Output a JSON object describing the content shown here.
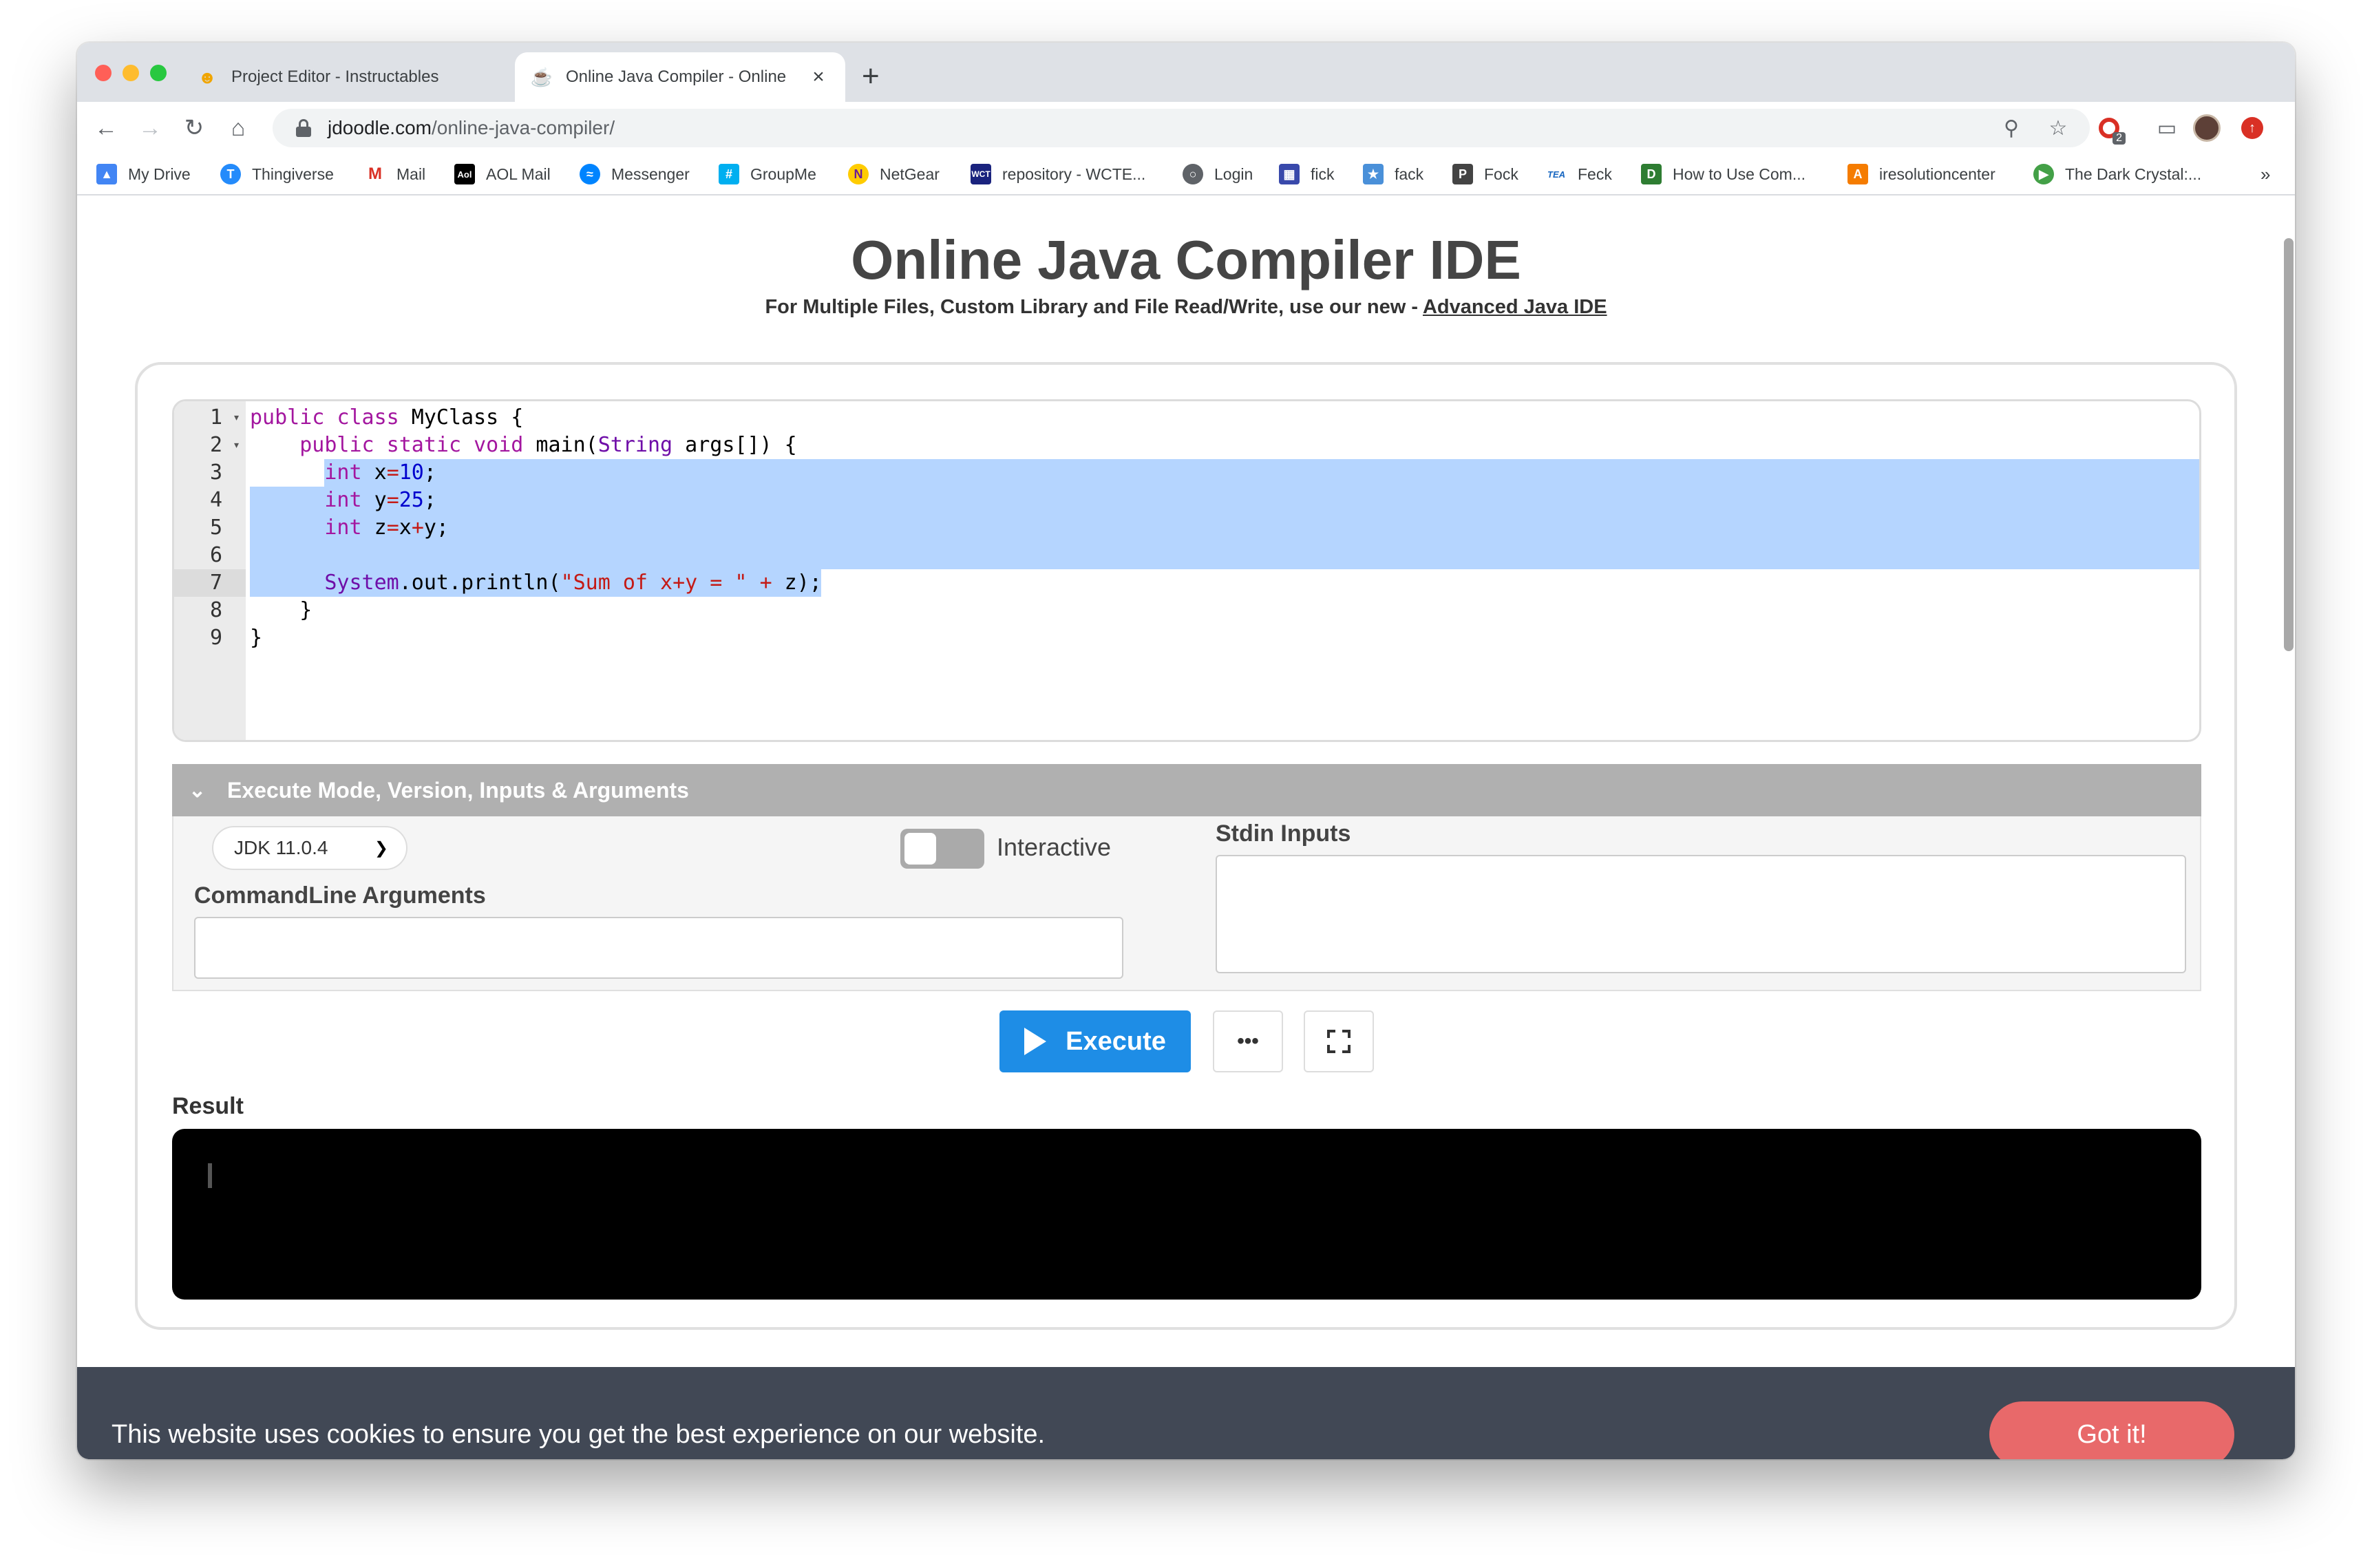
{
  "browser": {
    "tabs": [
      {
        "title": "Project Editor - Instructables",
        "active": false
      },
      {
        "title": "Online Java Compiler - Online",
        "active": true
      }
    ],
    "address": {
      "host": "jdoodle.com",
      "path": "/online-java-compiler/"
    },
    "extension_badge": "2",
    "bookmarks": [
      {
        "label": "My Drive",
        "icon": "drive-icon",
        "color": "#4285f4"
      },
      {
        "label": "Thingiverse",
        "icon": "thingiverse-icon",
        "color": "#248bfb"
      },
      {
        "label": "Mail",
        "icon": "gmail-icon",
        "color": "#d93025"
      },
      {
        "label": "AOL Mail",
        "icon": "aol-icon",
        "color": "#000000"
      },
      {
        "label": "Messenger",
        "icon": "messenger-icon",
        "color": "#0084ff"
      },
      {
        "label": "GroupMe",
        "icon": "groupme-icon",
        "color": "#00aff0"
      },
      {
        "label": "NetGear",
        "icon": "netgear-icon",
        "color": "#6a1b9a"
      },
      {
        "label": "repository - WCTE...",
        "icon": "wcte-icon",
        "color": "#1a237e"
      },
      {
        "label": "Login",
        "icon": "globe-icon",
        "color": "#5f6368"
      },
      {
        "label": "fick",
        "icon": "calendar-icon",
        "color": "#3949ab"
      },
      {
        "label": "fack",
        "icon": "star-icon",
        "color": "#4a90d9"
      },
      {
        "label": "Fock",
        "icon": "p-icon",
        "color": "#444444"
      },
      {
        "label": "Feck",
        "icon": "tea-icon",
        "color": "#1565c0"
      },
      {
        "label": "How to Use Com...",
        "icon": "doc-icon",
        "color": "#2e7d32"
      },
      {
        "label": "iresolutioncenter",
        "icon": "a-icon",
        "color": "#f57c00"
      },
      {
        "label": "The Dark Crystal:...",
        "icon": "play-icon",
        "color": "#43a047"
      }
    ],
    "bookmarks_overflow": "»"
  },
  "page": {
    "title": "Online Java Compiler IDE",
    "subtitle_prefix": "For Multiple Files, Custom Library and File Read/Write, use our new - ",
    "subtitle_link": "Advanced Java IDE",
    "line_numbers": [
      "1",
      "2",
      "3",
      "4",
      "5",
      "6",
      "7",
      "8",
      "9"
    ],
    "execute_panel": {
      "header": "Execute Mode, Version, Inputs & Arguments",
      "jdk_version": "JDK 11.0.4",
      "interactive_label": "Interactive",
      "interactive_on": false,
      "cmdline_label": "CommandLine Arguments",
      "cmdline_value": "",
      "stdin_label": "Stdin Inputs",
      "stdin_value": ""
    },
    "execute_label": "Execute",
    "more_label": "•••",
    "result_label": "Result",
    "result_output": ""
  },
  "cookie_banner": {
    "message": "This website uses cookies to ensure you get the best experience on our website.",
    "button": "Got it!"
  },
  "colors": {
    "execute_button": "#1e8de6",
    "cookie_button": "#e8696a",
    "cookie_bar": "#414855",
    "selection": "#b5d5ff"
  }
}
